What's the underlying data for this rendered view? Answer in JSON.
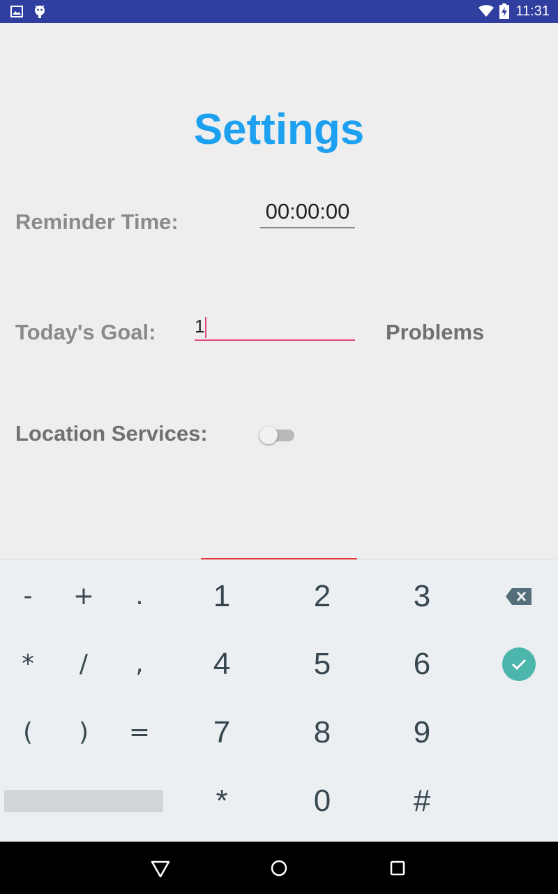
{
  "status_bar": {
    "time": "11:31",
    "icons": [
      "image-icon",
      "android-debug-icon",
      "wifi-icon",
      "battery-charging-icon"
    ],
    "background_color": "#303f9f"
  },
  "page": {
    "title": "Settings",
    "title_color": "#1ea0f0"
  },
  "settings": {
    "reminder_label": "Reminder Time:",
    "reminder_value": "00:00:00",
    "goal_label": "Today's Goal:",
    "goal_value": "1",
    "goal_unit": "Problems",
    "location_label": "Location Services:",
    "location_enabled": false
  },
  "keyboard": {
    "rows": [
      [
        "-",
        "+",
        ".",
        "1",
        "2",
        "3",
        "backspace"
      ],
      [
        "*",
        "/",
        ",",
        "4",
        "5",
        "6",
        "done"
      ],
      [
        "(",
        ")",
        "=",
        "7",
        "8",
        "9"
      ],
      [
        "space",
        "*",
        "0",
        "#"
      ]
    ],
    "keys": {
      "minus": "-",
      "plus": "+",
      "period": ".",
      "asterisk": "*",
      "slash": "/",
      "comma": ",",
      "open_paren": "(",
      "close_paren": ")",
      "equals": "=",
      "one": "1",
      "two": "2",
      "three": "3",
      "four": "4",
      "five": "5",
      "six": "6",
      "seven": "7",
      "eight": "8",
      "nine": "9",
      "star": "*",
      "zero": "0",
      "hash": "#"
    },
    "done_color": "#4db6ac"
  },
  "nav_bar": {
    "icons": [
      "back-icon",
      "home-icon",
      "recents-icon"
    ]
  }
}
